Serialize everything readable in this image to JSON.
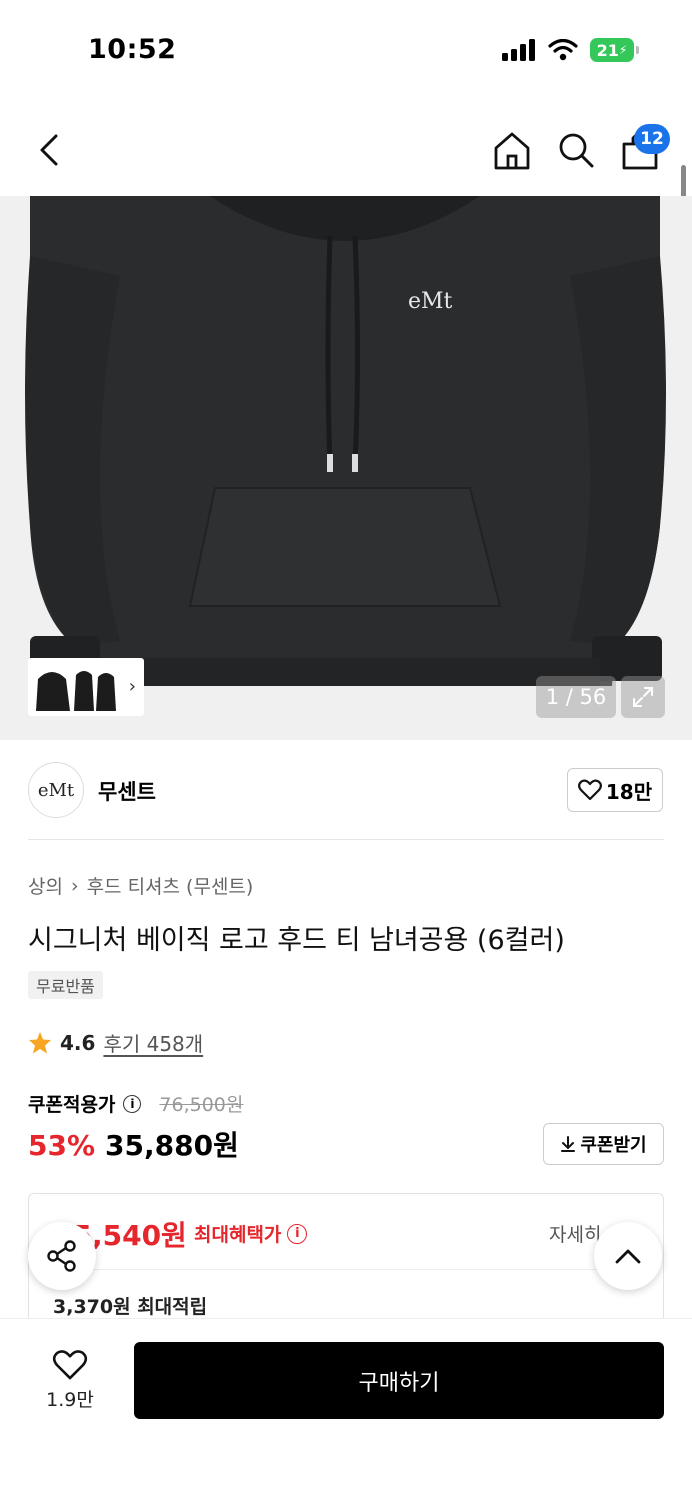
{
  "status_bar": {
    "time": "10:52",
    "battery": "21"
  },
  "header": {
    "cart_count": "12"
  },
  "gallery": {
    "counter": "1 / 56",
    "logo_text": "eMt"
  },
  "brand": {
    "logo_text": "eMt",
    "name": "무센트",
    "likes": "18만"
  },
  "product": {
    "breadcrumb": [
      "상의",
      "후드 티셔츠 (무센트)"
    ],
    "title": "시그니처 베이직 로고 후드 티 남녀공용 (6컬러)",
    "tag": "무료반품",
    "rating": "4.6",
    "reviews": "후기 458개"
  },
  "price": {
    "coupon_label": "쿠폰적용가",
    "original": "76,500원",
    "discount": "53%",
    "final": "35,880원",
    "coupon_button": "쿠폰받기"
  },
  "benefit": {
    "max_price": "35,540원",
    "max_label": "최대혜택가",
    "detail": "자세히",
    "points": "3,370원 최대적립"
  },
  "bottom": {
    "wish_count": "1.9만",
    "buy_label": "구매하기"
  },
  "colors": {
    "accent_red": "#e5262c",
    "badge_blue": "#1a73e8",
    "buy_bg": "#000000"
  }
}
